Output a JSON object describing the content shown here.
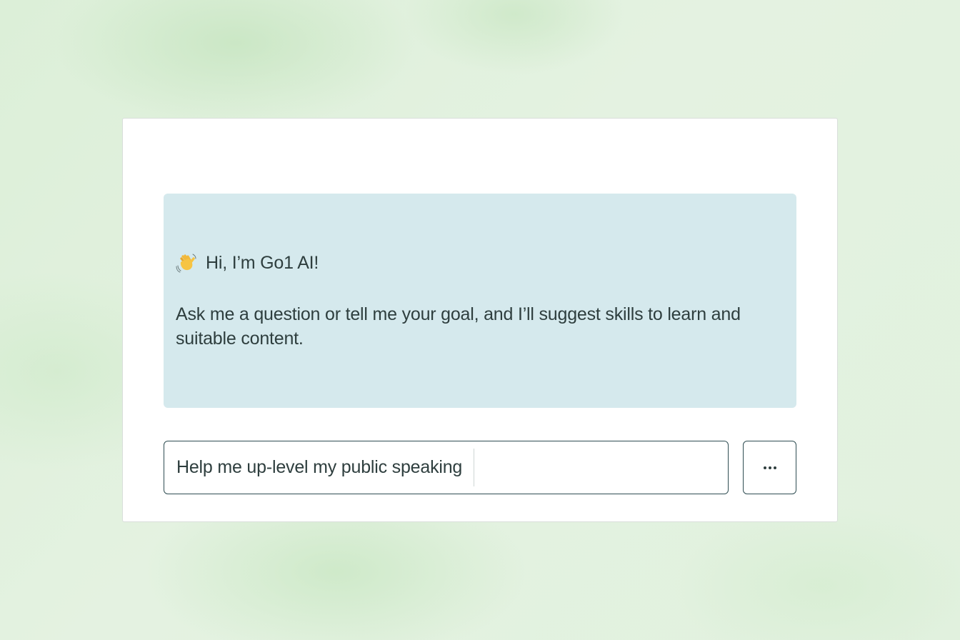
{
  "chat": {
    "greeting_emoji_icon": "waving-hand-icon",
    "greeting": "Hi, I’m Go1 AI!",
    "intro": "Ask me a question or tell me your goal, and I’ll suggest skills to learn and suitable content."
  },
  "composer": {
    "input_value": "Help me up-level my public speaking",
    "more_button_icon": "more-horizontal-icon"
  },
  "colors": {
    "background": "#e2f1df",
    "card": "#ffffff",
    "message_bubble": "#d5e9ed",
    "text": "#2e3e3e",
    "border": "#2f4d52"
  }
}
